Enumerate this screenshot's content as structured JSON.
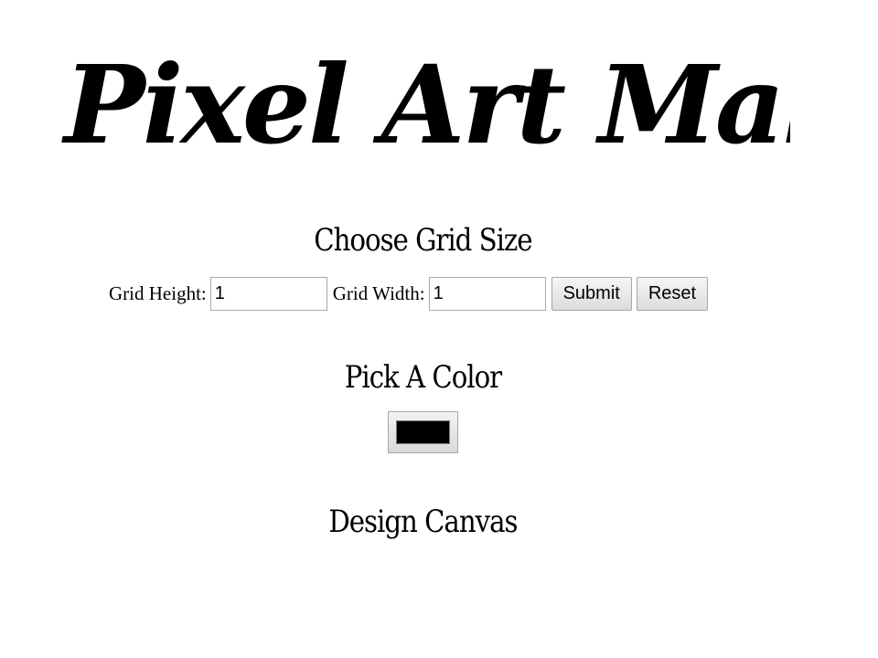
{
  "header": {
    "logo_text": "Pixel Art Maker"
  },
  "grid_size": {
    "title": "Choose Grid Size",
    "height_label": "Grid Height:",
    "height_value": "1",
    "width_label": "Grid Width:",
    "width_value": "1",
    "submit_label": "Submit",
    "reset_label": "Reset"
  },
  "color_picker": {
    "title": "Pick A Color",
    "value": "#000000"
  },
  "canvas": {
    "title": "Design Canvas"
  }
}
